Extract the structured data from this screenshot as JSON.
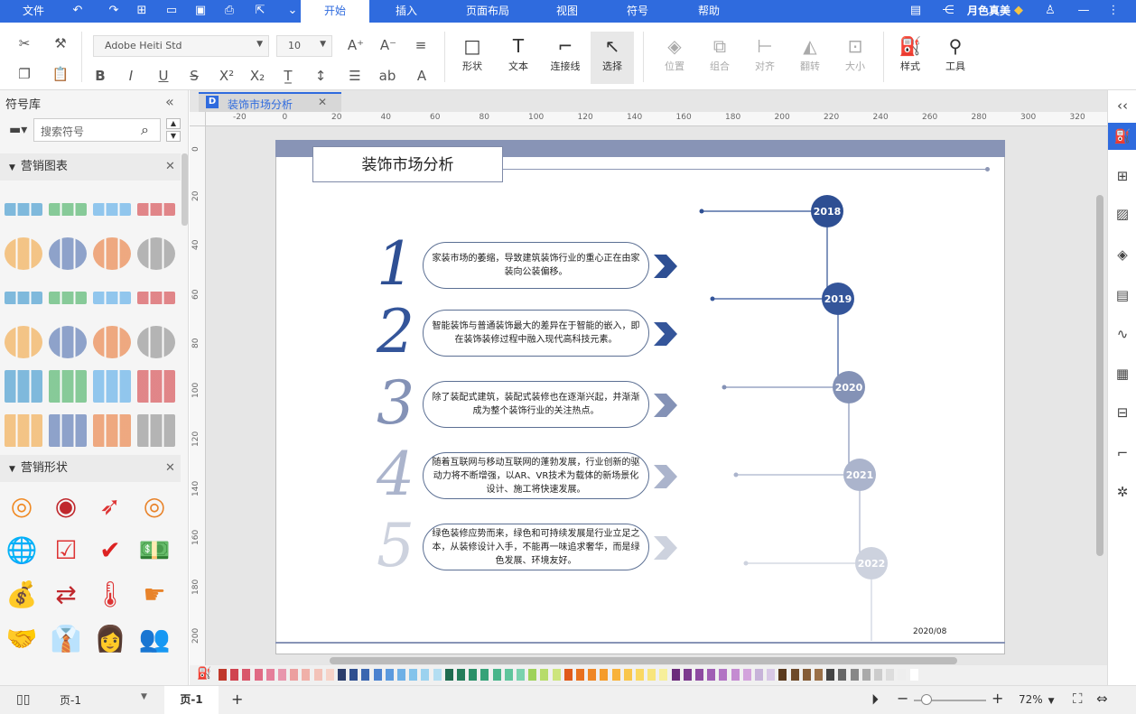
{
  "menu": {
    "file": "文件",
    "tabs": [
      "开始",
      "插入",
      "页面布局",
      "视图",
      "符号",
      "帮助"
    ],
    "user": "月色真美"
  },
  "toolbar": {
    "font_name": "Adobe Heiti Std",
    "font_size": "10",
    "big_buttons": [
      "形状",
      "文本",
      "连接线",
      "选择",
      "位置",
      "组合",
      "对齐",
      "翻转",
      "大小",
      "样式",
      "工具"
    ]
  },
  "left_panel": {
    "title": "符号库",
    "search_placeholder": "搜索符号",
    "section1": "营销图表",
    "section2": "营销形状"
  },
  "doc_tab": {
    "title": "装饰市场分析"
  },
  "ruler_h": [
    "-20",
    "0",
    "20",
    "40",
    "60",
    "80",
    "100",
    "120",
    "140",
    "160",
    "180",
    "200",
    "220",
    "240",
    "260",
    "280",
    "300",
    "320"
  ],
  "ruler_v": [
    "0",
    "20",
    "40",
    "60",
    "80",
    "100",
    "120",
    "140",
    "160",
    "180",
    "200"
  ],
  "diagram": {
    "title": "装饰市场分析",
    "date": "2020/08",
    "items": [
      {
        "num": "1",
        "text": "家装市场的萎缩，导致建筑装饰行业的重心正在由家装向公装偏移。"
      },
      {
        "num": "2",
        "text": "智能装饰与普通装饰最大的差异在于智能的嵌入，即在装饰装修过程中融入现代高科技元素。"
      },
      {
        "num": "3",
        "text": "除了装配式建筑，装配式装修也在逐渐兴起，并渐渐成为整个装饰行业的关注热点。"
      },
      {
        "num": "4",
        "text": "随着互联网与移动互联网的蓬勃发展，行业创新的驱动力将不断增强，以AR、VR技术为载体的新场景化设计、施工将快速发展。"
      },
      {
        "num": "5",
        "text": "绿色装修应势而来，绿色和可持续发展是行业立足之本，从装修设计入手，不能再一味追求奢华，而是绿色发展、环境友好。"
      }
    ],
    "years": [
      "2018",
      "2019",
      "2020",
      "2021",
      "2022"
    ],
    "colors": [
      "#2e4f93",
      "#34559a",
      "#8492b6",
      "#abb4cc",
      "#cdd2de"
    ]
  },
  "statusbar": {
    "page_select": "页-1",
    "page_tab": "页-1",
    "zoom": "72%"
  }
}
